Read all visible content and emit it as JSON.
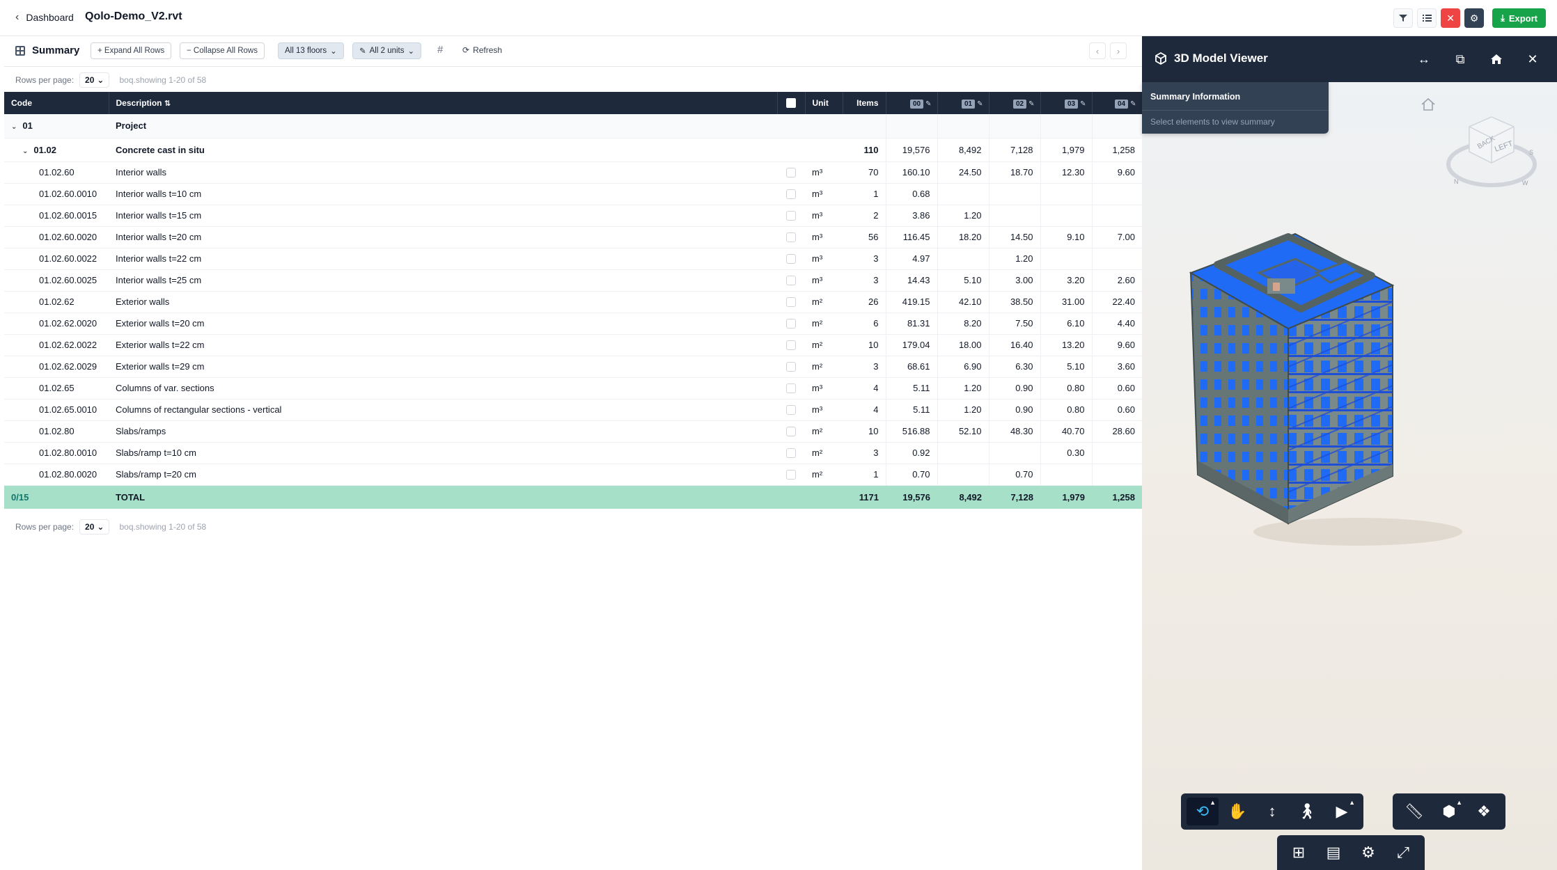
{
  "header": {
    "back_label": "Dashboard",
    "doc_title": "Qolo-Demo_V2.rvt",
    "export_label": "Export"
  },
  "toolbar": {
    "title": "Summary",
    "expand_label": "+ Expand All Rows",
    "collapse_label": "− Collapse All Rows",
    "floors_label": "All 13 floors",
    "units_label": "All 2 units",
    "hash": "#",
    "refresh_label": "Refresh"
  },
  "pagination": {
    "rows_label": "Rows per page:",
    "rows_value": "20",
    "showing": "boq.showing 1-20 of 58"
  },
  "columns": {
    "code": "Code",
    "description": "Description",
    "unit": "Unit",
    "items": "Items",
    "floors": [
      "00",
      "01",
      "02",
      "03",
      "04"
    ]
  },
  "group": {
    "code": "01",
    "description": "Project"
  },
  "subgroup": {
    "code": "01.02",
    "description": "Concrete cast in situ",
    "items": "110",
    "floors": [
      "19,576",
      "8,492",
      "7,128",
      "1,979",
      "1,258"
    ]
  },
  "rows": [
    {
      "code": "01.02.60",
      "desc": "Interior walls",
      "unit": "m³",
      "items": "70",
      "f": [
        "160.10",
        "24.50",
        "18.70",
        "12.30",
        "9.60"
      ]
    },
    {
      "code": "01.02.60.0010",
      "desc": "Interior walls t=10 cm",
      "unit": "m³",
      "items": "1",
      "f": [
        "0.68",
        "",
        "",
        "",
        ""
      ]
    },
    {
      "code": "01.02.60.0015",
      "desc": "Interior walls t=15 cm",
      "unit": "m³",
      "items": "2",
      "f": [
        "3.86",
        "1.20",
        "",
        "",
        ""
      ]
    },
    {
      "code": "01.02.60.0020",
      "desc": "Interior walls t=20 cm",
      "unit": "m³",
      "items": "56",
      "f": [
        "116.45",
        "18.20",
        "14.50",
        "9.10",
        "7.00"
      ]
    },
    {
      "code": "01.02.60.0022",
      "desc": "Interior walls t=22 cm",
      "unit": "m³",
      "items": "3",
      "f": [
        "4.97",
        "",
        "1.20",
        "",
        ""
      ]
    },
    {
      "code": "01.02.60.0025",
      "desc": "Interior walls t=25 cm",
      "unit": "m³",
      "items": "3",
      "f": [
        "14.43",
        "5.10",
        "3.00",
        "3.20",
        "2.60"
      ]
    },
    {
      "code": "01.02.62",
      "desc": "Exterior walls",
      "unit": "m²",
      "items": "26",
      "f": [
        "419.15",
        "42.10",
        "38.50",
        "31.00",
        "22.40"
      ]
    },
    {
      "code": "01.02.62.0020",
      "desc": "Exterior walls t=20 cm",
      "unit": "m²",
      "items": "6",
      "f": [
        "81.31",
        "8.20",
        "7.50",
        "6.10",
        "4.40"
      ]
    },
    {
      "code": "01.02.62.0022",
      "desc": "Exterior walls t=22 cm",
      "unit": "m²",
      "items": "10",
      "f": [
        "179.04",
        "18.00",
        "16.40",
        "13.20",
        "9.60"
      ]
    },
    {
      "code": "01.02.62.0029",
      "desc": "Exterior walls t=29 cm",
      "unit": "m²",
      "items": "3",
      "f": [
        "68.61",
        "6.90",
        "6.30",
        "5.10",
        "3.60"
      ]
    },
    {
      "code": "01.02.65",
      "desc": "Columns of var. sections",
      "unit": "m³",
      "items": "4",
      "f": [
        "5.11",
        "1.20",
        "0.90",
        "0.80",
        "0.60"
      ]
    },
    {
      "code": "01.02.65.0010",
      "desc": "Columns of rectangular sections - vertical",
      "unit": "m³",
      "items": "4",
      "f": [
        "5.11",
        "1.20",
        "0.90",
        "0.80",
        "0.60"
      ]
    },
    {
      "code": "01.02.80",
      "desc": "Slabs/ramps",
      "unit": "m²",
      "items": "10",
      "f": [
        "516.88",
        "52.10",
        "48.30",
        "40.70",
        "28.60"
      ]
    },
    {
      "code": "01.02.80.0010",
      "desc": "Slabs/ramp t=10 cm",
      "unit": "m²",
      "items": "3",
      "f": [
        "0.92",
        "",
        "",
        "0.30",
        ""
      ]
    },
    {
      "code": "01.02.80.0020",
      "desc": "Slabs/ramp t=20 cm",
      "unit": "m²",
      "items": "1",
      "f": [
        "0.70",
        "",
        "0.70",
        "",
        ""
      ]
    }
  ],
  "total": {
    "selected": "0/15",
    "label": "TOTAL",
    "items": "1171",
    "floors": [
      "19,576",
      "8,492",
      "7,128",
      "1,979",
      "1,258"
    ]
  },
  "viewer": {
    "title": "3D Model Viewer",
    "summary_title": "Summary Information",
    "summary_hint": "Select elements to view summary",
    "cube_labels": [
      "BACK",
      "LEFT",
      "S",
      "W",
      "N"
    ]
  },
  "colors": {
    "header_dark": "#1e293b",
    "total_green": "#a7e0c9",
    "export_green": "#16a34a",
    "accent_blue": "#2563eb",
    "model_blue": "#1f6bf5",
    "model_gray": "#6f7f7f"
  }
}
